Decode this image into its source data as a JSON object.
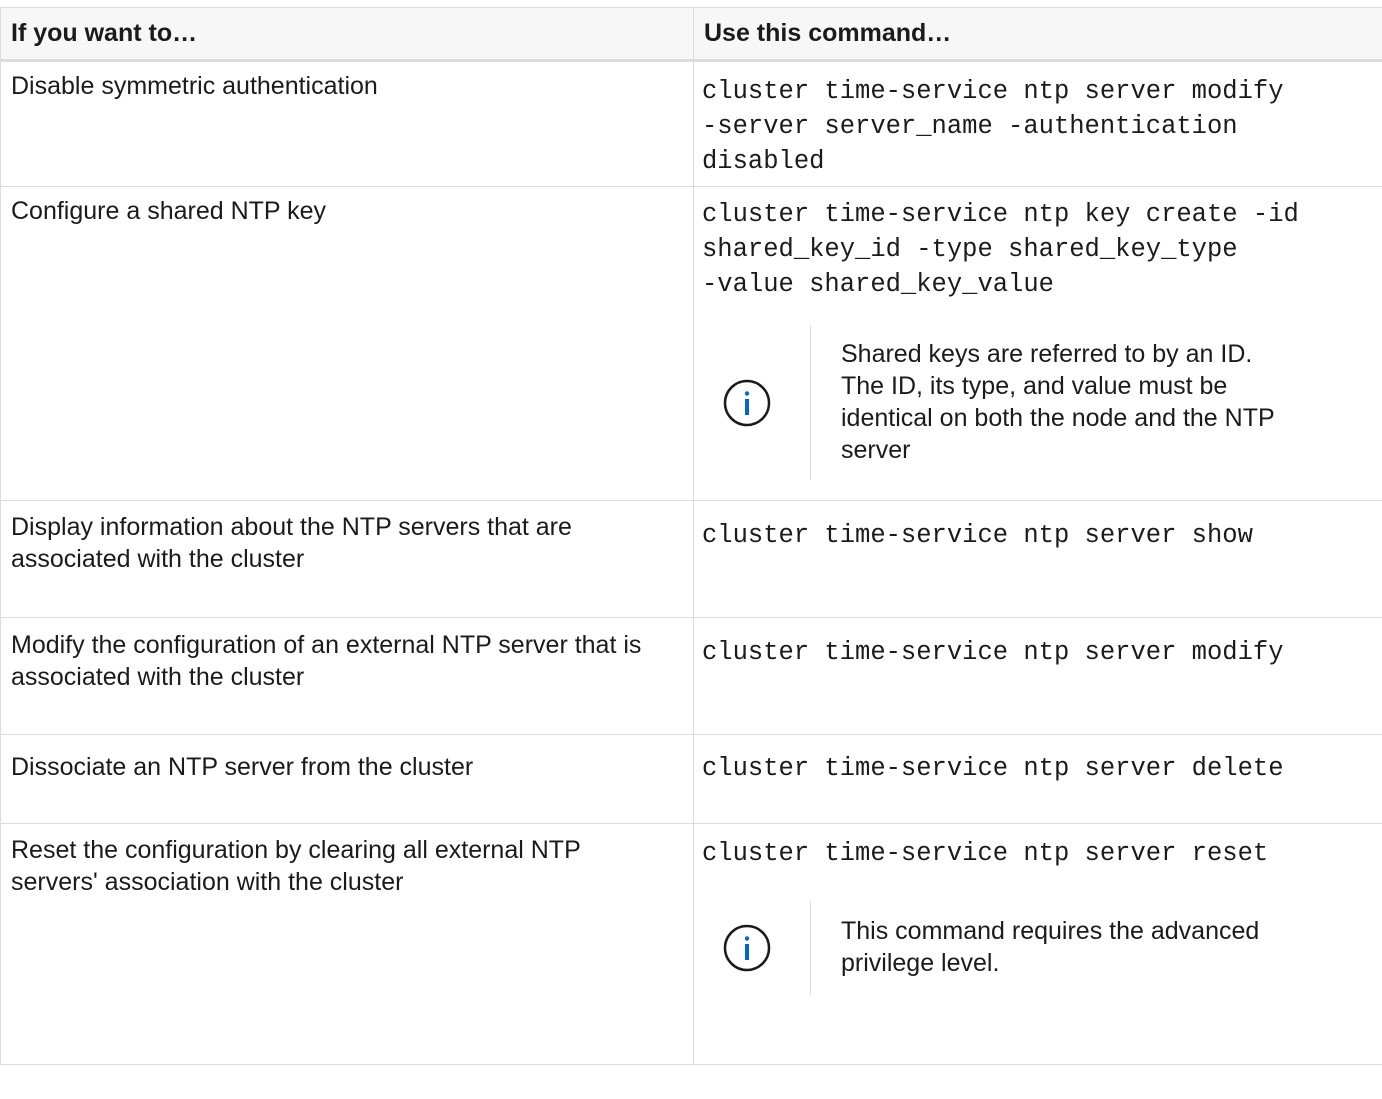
{
  "table": {
    "headers": [
      "If you want to…",
      "Use this command…"
    ],
    "rows": [
      {
        "description": "Disable symmetric authentication",
        "command": "cluster time-service ntp server modify\n-server server_name -authentication\ndisabled"
      },
      {
        "description": "Configure a shared NTP key",
        "command": "cluster time-service ntp key create -id\nshared_key_id -type shared_key_type\n-value shared_key_value",
        "note": "Shared keys are referred to by an ID. The ID, its type, and value must be identical on both the node and the NTP server"
      },
      {
        "description": "Display information about the NTP servers that are associated with the cluster",
        "command": "cluster time-service ntp server show"
      },
      {
        "description": "Modify the configuration of an external NTP server that is associated with the cluster",
        "command": "cluster time-service ntp server modify"
      },
      {
        "description": "Dissociate an NTP server from the cluster",
        "command": "cluster time-service ntp server delete"
      },
      {
        "description": "Reset the configuration by clearing all external NTP servers' association with the cluster",
        "command": "cluster time-service ntp server reset",
        "note": "This command requires the advanced privilege level."
      }
    ]
  },
  "icons": {
    "note_icon": "info-circle-icon"
  },
  "colors": {
    "icon": "#0067c5",
    "border": "#dcdcdc",
    "header_bg": "#f7f7f7"
  }
}
